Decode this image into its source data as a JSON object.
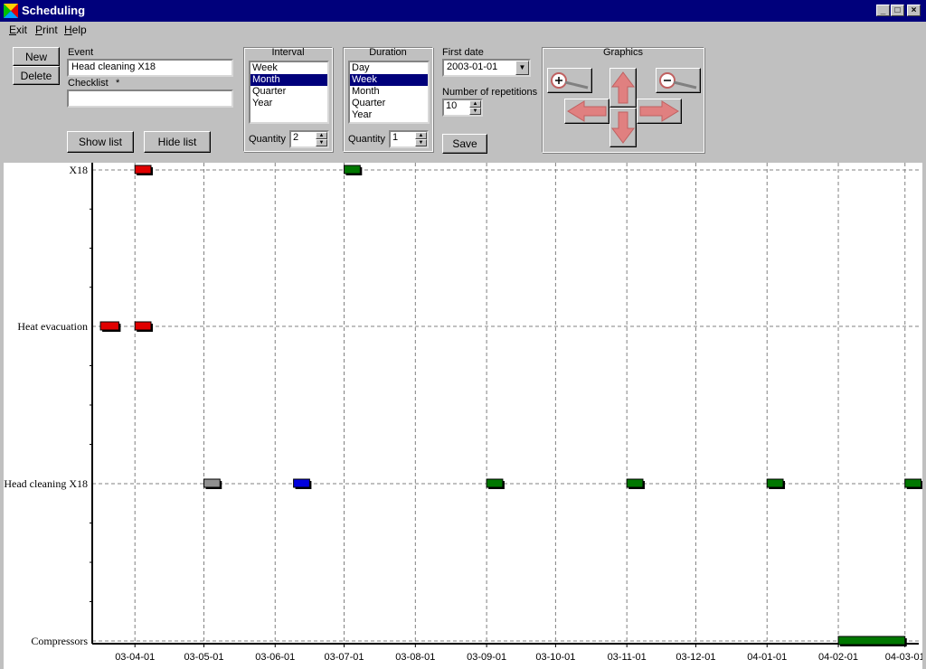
{
  "window": {
    "title": "Scheduling"
  },
  "menu": [
    {
      "label": "Exit",
      "key": "E",
      "rest": "xit"
    },
    {
      "label": "Print",
      "key": "P",
      "rest": "rint"
    },
    {
      "label": "Help",
      "key": "H",
      "rest": "elp"
    }
  ],
  "buttons": {
    "new": "New",
    "delete": "Delete",
    "show_list": "Show list",
    "hide_list": "Hide list",
    "save": "Save"
  },
  "event": {
    "label": "Event",
    "value": "Head cleaning X18"
  },
  "checklist": {
    "label": "Checklist",
    "marker": "*",
    "value": ""
  },
  "interval": {
    "title": "Interval",
    "options": [
      "Week",
      "Month",
      "Quarter",
      "Year"
    ],
    "selected": "Month",
    "quantity_label": "Quantity",
    "quantity": "2"
  },
  "duration": {
    "title": "Duration",
    "options": [
      "Day",
      "Week",
      "Month",
      "Quarter",
      "Year"
    ],
    "selected": "Week",
    "quantity_label": "Quantity",
    "quantity": "1"
  },
  "first_date": {
    "label": "First date",
    "value": "2003-01-01"
  },
  "repetitions": {
    "label": "Number of repetitions",
    "value": "10"
  },
  "graphics": {
    "title": "Graphics",
    "icons": [
      "zoom-in-icon",
      "zoom-out-icon",
      "arrow-up-icon",
      "arrow-down-icon",
      "arrow-left-icon",
      "arrow-right-icon"
    ]
  },
  "chart_data": {
    "type": "gantt",
    "categories": [
      "X18",
      "Heat evacuation",
      "Head cleaning X18",
      "Compressors"
    ],
    "x_ticks": [
      "03-04-01",
      "03-05-01",
      "03-06-01",
      "03-07-01",
      "03-08-01",
      "03-09-01",
      "03-10-01",
      "03-11-01",
      "03-12-01",
      "04-01-01",
      "04-02-01",
      "04-03-01"
    ],
    "x_range": [
      "2003-03-15",
      "2004-03-07"
    ],
    "grid": true,
    "colors": {
      "red": "#e00000",
      "green": "#007700",
      "gray": "#909090",
      "blue": "#0000dd"
    },
    "bars": [
      {
        "category": "X18",
        "start": "2003-04-01",
        "end": "2003-04-08",
        "color": "red"
      },
      {
        "category": "X18",
        "start": "2003-07-01",
        "end": "2003-07-08",
        "color": "green"
      },
      {
        "category": "Heat evacuation",
        "start": "2003-03-17",
        "end": "2003-03-25",
        "color": "red"
      },
      {
        "category": "Heat evacuation",
        "start": "2003-04-01",
        "end": "2003-04-08",
        "color": "red"
      },
      {
        "category": "Head cleaning X18",
        "start": "2003-05-01",
        "end": "2003-05-08",
        "color": "gray"
      },
      {
        "category": "Head cleaning X18",
        "start": "2003-06-09",
        "end": "2003-06-16",
        "color": "blue"
      },
      {
        "category": "Head cleaning X18",
        "start": "2003-09-01",
        "end": "2003-09-08",
        "color": "green"
      },
      {
        "category": "Head cleaning X18",
        "start": "2003-11-01",
        "end": "2003-11-08",
        "color": "green"
      },
      {
        "category": "Head cleaning X18",
        "start": "2004-01-01",
        "end": "2004-01-08",
        "color": "green"
      },
      {
        "category": "Head cleaning X18",
        "start": "2004-03-01",
        "end": "2004-03-08",
        "color": "green"
      },
      {
        "category": "Compressors",
        "start": "2004-02-01",
        "end": "2004-03-01",
        "color": "green"
      }
    ]
  }
}
